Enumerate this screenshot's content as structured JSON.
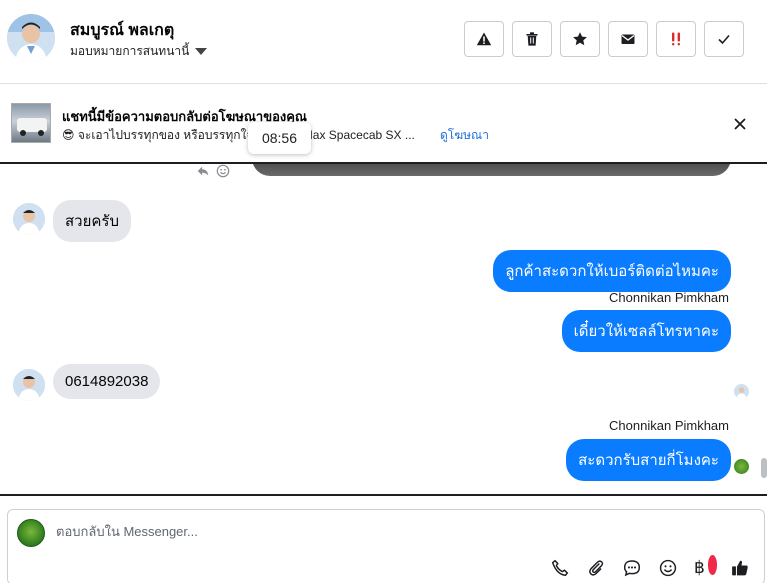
{
  "header": {
    "contact_name": "สมบูรณ์ พลเกตุ",
    "assign_label": "มอบหมายการสนทนานี้",
    "actions": [
      {
        "name": "spam-button",
        "icon": "warning-icon"
      },
      {
        "name": "delete-button",
        "icon": "trash-icon"
      },
      {
        "name": "star-button",
        "icon": "star-icon"
      },
      {
        "name": "mark-unread-button",
        "icon": "envelope-icon"
      },
      {
        "name": "follow-up-button",
        "icon": "double-exclamation-icon"
      },
      {
        "name": "done-button",
        "icon": "check-icon"
      }
    ]
  },
  "ad_banner": {
    "title": "แชทนี้มีข้อความตอบกลับต่อโฆษณาของคุณ",
    "subtitle": "😎 จะเอาไปบรรทุกของ หรือบรรทุกใจ",
    "subtitle_tail": "D-Max Spacecab SX ...",
    "link": "ดูโฆษณา",
    "tooltip_time": "08:56"
  },
  "messages": [
    {
      "direction": "in",
      "text": "สวยครับ"
    },
    {
      "direction": "out",
      "text": "ลูกค้าสะดวกให้เบอร์ติดต่อไหมคะ",
      "sender": "Chonnikan Pimkham"
    },
    {
      "direction": "out",
      "text": "เดี๋ยวให้เซลล์โทรหาคะ"
    },
    {
      "direction": "in",
      "text": "0614892038"
    },
    {
      "direction": "out",
      "text": "สะดวกรับสายกี่โมงคะ",
      "sender": "Chonnikan Pimkham"
    }
  ],
  "composer": {
    "placeholder": "ตอบกลับใน Messenger...",
    "tools": [
      "phone-icon",
      "paperclip-icon",
      "quick-reply-icon",
      "emoji-icon",
      "baht-icon",
      "thumbs-up-icon"
    ],
    "baht_symbol": "฿"
  },
  "colors": {
    "outgoing_bubble": "#0a7cff",
    "incoming_bubble": "#e4e6eb",
    "link": "#216fdb"
  }
}
